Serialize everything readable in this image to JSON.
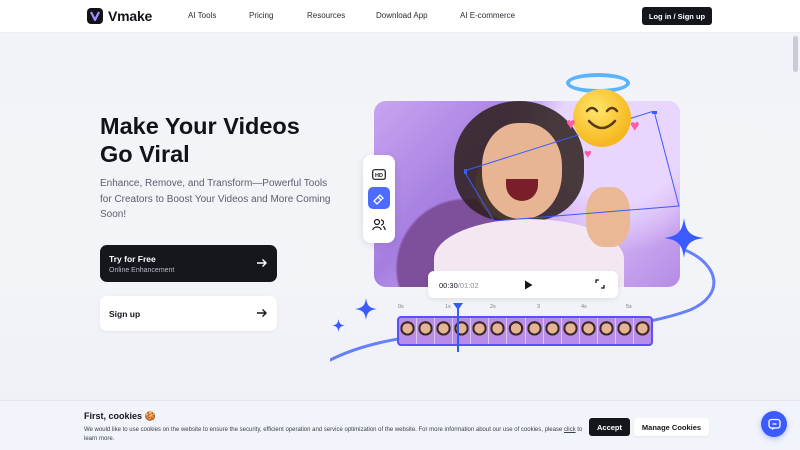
{
  "header": {
    "brand": "Vmake",
    "nav": [
      "AI Tools",
      "Pricing",
      "Resources",
      "Download App",
      "AI E-commerce"
    ],
    "login_label": "Log in / Sign up"
  },
  "hero": {
    "headline_line1": "Make Your Videos",
    "headline_line2": "Go Viral",
    "subtext": "Enhance, Remove, and Transform—Powerful Tools for Creators to Boost Your Videos and More Coming Soon!",
    "cta_primary": {
      "title": "Try for Free",
      "subtitle": "Online Enhancement"
    },
    "cta_secondary": {
      "title": "Sign up"
    }
  },
  "player": {
    "current_time": "00:30",
    "total_time": "/01:02",
    "timeline_ticks": [
      "0s",
      "1s",
      "2s",
      "3",
      "4s",
      "5s"
    ],
    "tools": [
      "hd-icon",
      "eraser-icon",
      "people-icon"
    ]
  },
  "cookie": {
    "title": "First, cookies 🍪",
    "text_before_link": "We would like to use cookies on the website to ensure the security, efficient operation and service optimization of the website. For more information about our use of cookies, please ",
    "link_text": "click",
    "text_after_link": " to learn more.",
    "accept_label": "Accept",
    "manage_label": "Manage Cookies"
  },
  "colors": {
    "accent": "#3b5bff",
    "dark": "#14161b"
  }
}
